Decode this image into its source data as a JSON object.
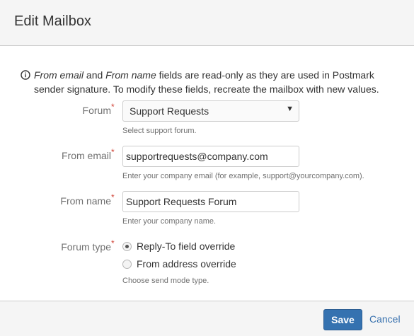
{
  "dialog": {
    "title": "Edit Mailbox"
  },
  "info": {
    "icon": "info-circle-icon",
    "from_email_term": "From email",
    "and": " and ",
    "from_name_term": "From name",
    "line1_rest": " fields are read-only as they are used in Postmark",
    "line2": "sender signature. To modify these fields, recreate the mailbox with new values."
  },
  "form": {
    "forum": {
      "label": "Forum",
      "required_mark": "*",
      "selected": "Support Requests",
      "help": "Select support forum."
    },
    "from_email": {
      "label": "From email",
      "required_mark": "*",
      "value": "supportrequests@company.com",
      "help": "Enter your company email (for example, support@yourcompany.com)."
    },
    "from_name": {
      "label": "From name",
      "required_mark": "*",
      "value": "Support Requests Forum",
      "help": "Enter your company name."
    },
    "forum_type": {
      "label": "Forum type",
      "required_mark": "*",
      "options": [
        "Reply-To field override",
        "From address override"
      ],
      "selected_index": 0,
      "help": "Choose send mode type."
    }
  },
  "footer": {
    "save_label": "Save",
    "cancel_label": "Cancel"
  },
  "colors": {
    "primary": "#3572b0",
    "link": "#3b73af",
    "required": "#d04437"
  }
}
